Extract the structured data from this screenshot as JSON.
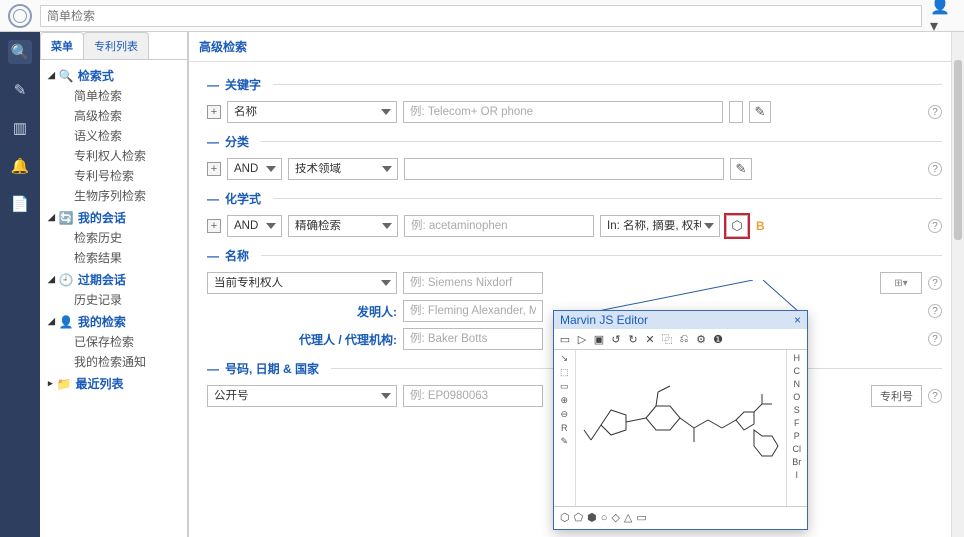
{
  "topbar": {
    "search_placeholder": "简单检索"
  },
  "tabs": {
    "menu": "菜单",
    "patent_list": "专利列表"
  },
  "tree": {
    "g1": {
      "t": "检索式",
      "items": [
        "简单检索",
        "高级检索",
        "语义检索",
        "专利权人检索",
        "专利号检索",
        "生物序列检索"
      ]
    },
    "g2": {
      "t": "我的会话",
      "items": [
        "检索历史",
        "检索结果"
      ]
    },
    "g3": {
      "t": "过期会话",
      "items": [
        "历史记录"
      ]
    },
    "g4": {
      "t": "我的检索",
      "items": [
        "已保存检索",
        "我的检索通知"
      ]
    },
    "g5": {
      "t": "最近列表",
      "items": []
    }
  },
  "content_title": "高级检索",
  "sections": {
    "kw": "关键字",
    "cls": "分类",
    "chem": "化学式",
    "names": "名称",
    "codes": "号码, 日期 & 国家"
  },
  "fields": {
    "name_sel": "名称",
    "name_ph": "例: Telecom+ OR phone",
    "and": "AND",
    "tech_field": "技术领域",
    "exact": "精确检索",
    "chem_ph": "例: acetaminophen",
    "chem_scope": "In: 名称, 摘要, 权利要求",
    "current_owner": "当前专利权人",
    "owner_ph": "例: Siemens Nixdorf",
    "inventor_lbl": "发明人:",
    "inventor_ph": "例: Fleming Alexander, Moyer An",
    "agent_lbl": "代理人 / 代理机构:",
    "agent_ph": "例: Baker Botts",
    "pubno": "公开号",
    "pubno_ph": "例: EP0980063",
    "pubno_btn": "专利号",
    "badge": "B"
  },
  "editor": {
    "title": "Marvin JS Editor",
    "close": "×",
    "top_icons": [
      "▭",
      "▷",
      "▣",
      "↺",
      "↻",
      "✕",
      "⿻",
      "⎌",
      "⚙",
      "❶"
    ],
    "left_icons": [
      "↘",
      "⬚",
      "▭",
      "⊕",
      "⊖",
      "R",
      "✎"
    ],
    "right_icons": [
      "H",
      "C",
      "N",
      "O",
      "S",
      "F",
      "P",
      "Cl",
      "Br",
      "I"
    ],
    "bottom_icons": [
      "⬡",
      "⬠",
      "⬢",
      "○",
      "◇",
      "△",
      "▭"
    ]
  }
}
